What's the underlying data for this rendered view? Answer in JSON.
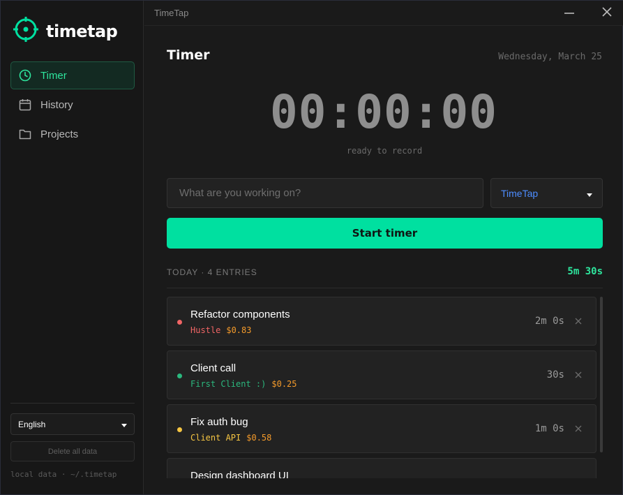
{
  "brand": {
    "name": "timetap",
    "logo_icon": "crosshair-logo-icon"
  },
  "sidebar": {
    "items": [
      {
        "label": "Timer",
        "icon": "clock-icon",
        "active": true
      },
      {
        "label": "History",
        "icon": "calendar-icon",
        "active": false
      },
      {
        "label": "Projects",
        "icon": "folder-icon",
        "active": false
      }
    ],
    "language": "English",
    "delete_label": "Delete all data",
    "local_data": "local data · ~/.timetap"
  },
  "titlebar": {
    "title": "TimeTap"
  },
  "main": {
    "title": "Timer",
    "date": "Wednesday, March 25",
    "clock": "00:00:00",
    "status": "ready to record",
    "task_placeholder": "What are you working on?",
    "task_value": "",
    "project": "TimeTap",
    "start_label": "Start timer",
    "today_label": "TODAY · 4 ENTRIES",
    "today_total": "5m 30s"
  },
  "entries": [
    {
      "name": "Refactor components",
      "project": "Hustle",
      "cost": "$0.83",
      "duration": "2m 0s",
      "color": "#f06565"
    },
    {
      "name": "Client call",
      "project": "First Client :)",
      "cost": "$0.25",
      "duration": "30s",
      "color": "#2bb87e"
    },
    {
      "name": "Fix auth bug",
      "project": "Client API",
      "cost": "$0.58",
      "duration": "1m 0s",
      "color": "#f5c542"
    },
    {
      "name": "Design dashboard UI",
      "project": "",
      "cost": "",
      "duration": "",
      "color": "#888888"
    }
  ],
  "colors": {
    "accent": "#00e0a0",
    "accent_text": "#2ee59d",
    "project_link": "#4d8dff",
    "cost": "#f59b2b"
  }
}
